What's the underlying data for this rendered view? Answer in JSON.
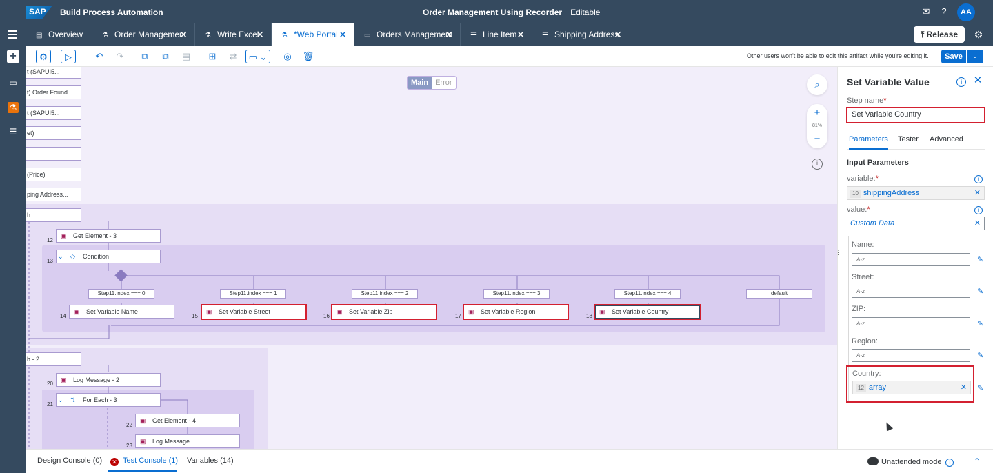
{
  "shell": {
    "logo": "SAP",
    "product": "Build Process Automation",
    "project": "Order Management Using Recorder",
    "mode": "Editable",
    "avatar": "AA"
  },
  "tabs": [
    {
      "label": "Overview",
      "icon": "doc-icon",
      "closable": false
    },
    {
      "label": "Order Management",
      "icon": "process-icon",
      "closable": true
    },
    {
      "label": "Write Excel",
      "icon": "process-icon",
      "closable": true
    },
    {
      "label": "*Web Portal",
      "icon": "process-icon",
      "closable": true,
      "active": true
    },
    {
      "label": "Orders Management",
      "icon": "monitor-icon",
      "closable": true
    },
    {
      "label": "Line Item",
      "icon": "datatype-icon",
      "closable": true
    },
    {
      "label": "Shipping Address",
      "icon": "datatype-icon",
      "closable": true
    }
  ],
  "release_label": "Release",
  "toolbar": {
    "lock_message": "Other users won't be able to edit this artifact while you're editing it.",
    "save_label": "Save"
  },
  "canvas": {
    "view_toggle": {
      "main": "Main",
      "error": "Error"
    },
    "zoom": {
      "plus": "+",
      "percent": "81%",
      "minus": "−"
    },
    "top_nodes": [
      "t (SAPUI5...",
      "t) Order Found",
      "t (SAPUI5...",
      "et)",
      "",
      "(Price)",
      "ping Address...",
      "h"
    ],
    "steps": {
      "s12": {
        "num": "12",
        "label": "Get Element - 3"
      },
      "s13": {
        "num": "13",
        "label": "Condition"
      },
      "s14": {
        "num": "14",
        "label": "Set Variable Name"
      },
      "s15": {
        "num": "15",
        "label": "Set Variable Street"
      },
      "s16": {
        "num": "16",
        "label": "Set Variable Zip"
      },
      "s17": {
        "num": "17",
        "label": "Set Variable Region"
      },
      "s18": {
        "num": "18",
        "label": "Set Variable Country"
      },
      "foreach2": {
        "label": "h - 2"
      },
      "s20": {
        "num": "20",
        "label": "Log Message - 2"
      },
      "s21": {
        "num": "21",
        "label": "For Each - 3"
      },
      "s22": {
        "num": "22",
        "label": "Get Element - 4"
      },
      "s23": {
        "num": "23",
        "label": "Log Message"
      }
    },
    "conditions": [
      "Step11.index === 0",
      "Step11.index === 1",
      "Step11.index === 2",
      "Step11.index === 3",
      "Step11.index === 4",
      "default"
    ]
  },
  "panel": {
    "title": "Set Variable Value",
    "step_name_label": "Step name",
    "step_name_value": "Set Variable Country",
    "tabs": [
      "Parameters",
      "Tester",
      "Advanced"
    ],
    "section": "Input Parameters",
    "variable_label": "variable:",
    "variable_badge": "10",
    "variable_value": "shippingAddress",
    "value_label": "value:",
    "value_value": "Custom Data",
    "fields": [
      {
        "label": "Name:",
        "placeholder": "A-z"
      },
      {
        "label": "Street:",
        "placeholder": "A-z"
      },
      {
        "label": "ZIP:",
        "placeholder": "A-z"
      },
      {
        "label": "Region:",
        "placeholder": "A-z"
      }
    ],
    "country_label": "Country:",
    "country_badge": "12",
    "country_value": "array"
  },
  "bottom": {
    "tabs": [
      "Design Console (0)",
      "Test Console (1)",
      "Variables (14)"
    ],
    "unattended": "Unattended mode"
  }
}
